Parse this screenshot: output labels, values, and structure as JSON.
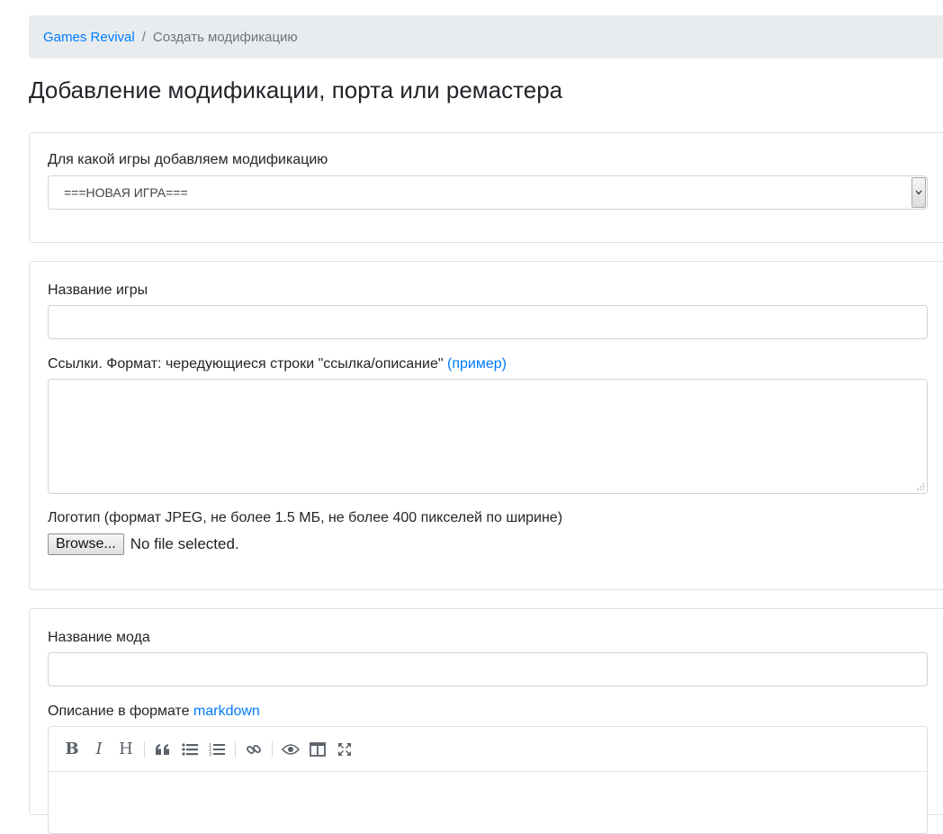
{
  "breadcrumb": {
    "home": "Games Revival",
    "separator": "/",
    "current": "Создать модификацию"
  },
  "page": {
    "title": "Добавление модификации, порта или ремастера"
  },
  "game_select": {
    "label": "Для какой игры добавляем модификацию",
    "selected": "===НОВАЯ ИГРА==="
  },
  "game_form": {
    "name_label": "Название игры",
    "links_label": "Ссылки. Формат: чередующиеся строки \"ссылка/описание\"",
    "links_example": "(пример)",
    "logo_label": "Логотип (формат JPEG, не более 1.5 МБ, не более 400 пикселей по ширине)",
    "browse_label": "Browse...",
    "file_status": "No file selected."
  },
  "mod_form": {
    "name_label": "Название мода",
    "description_label": "Описание в формате",
    "description_link": "markdown"
  },
  "editor_toolbar": {
    "icons": [
      "bold-icon",
      "italic-icon",
      "heading-icon",
      "quote-icon",
      "unordered-list-icon",
      "ordered-list-icon",
      "link-icon",
      "preview-icon",
      "side-by-side-icon",
      "fullscreen-icon"
    ],
    "bold": "B",
    "italic": "I",
    "heading": "H"
  },
  "colors": {
    "link": "#007bff",
    "breadcrumb_bg": "#e9ecef",
    "border": "#ced4da"
  }
}
